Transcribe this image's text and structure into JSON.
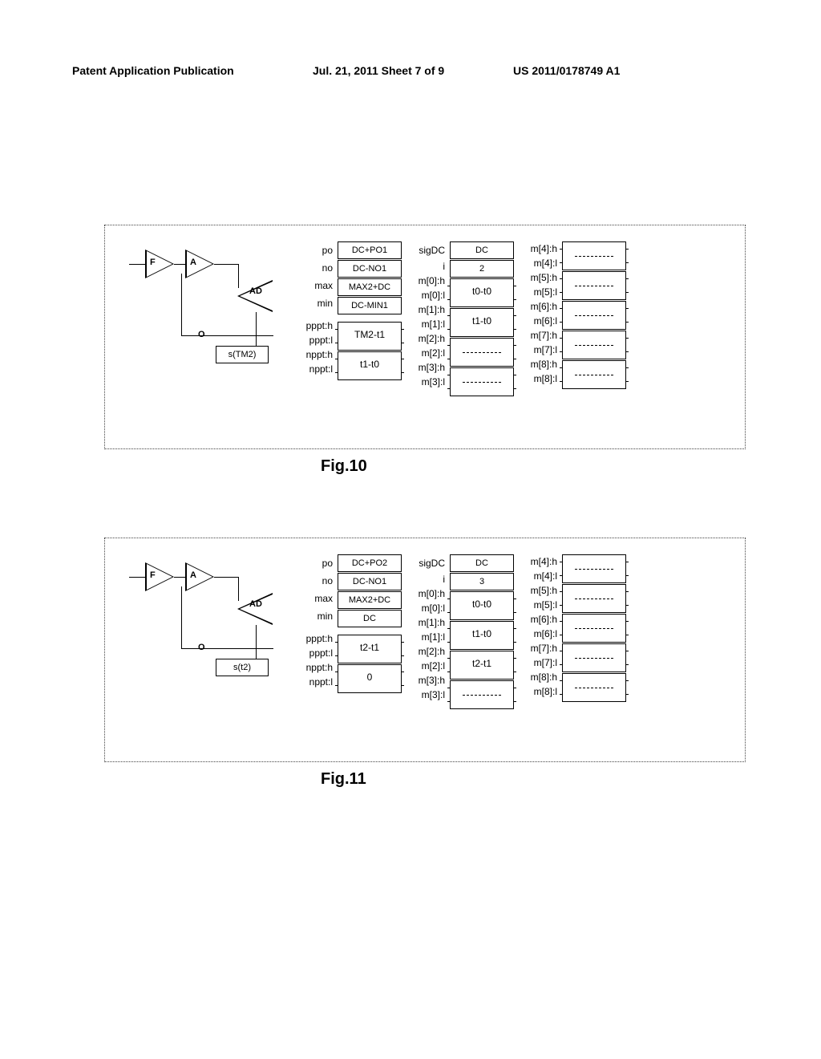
{
  "header": {
    "left": "Patent Application Publication",
    "mid": "Jul. 21, 2011  Sheet 7 of 9",
    "right": "US 2011/0178749 A1"
  },
  "fig10": {
    "label": "Fig.10",
    "schematic": {
      "F": "F",
      "A": "A",
      "AD": "AD",
      "O": "O",
      "s": "s(TM2)"
    },
    "col1": {
      "labels": [
        "po",
        "no",
        "max",
        "min",
        "pppt:h",
        "pppt:l",
        "nppt:h",
        "nppt:l"
      ],
      "cells4": [
        "DC+PO1",
        "DC-NO1",
        "MAX2+DC",
        "DC-MIN1"
      ],
      "cellsPair": [
        "TM2-t1",
        "t1-t0"
      ]
    },
    "col2": {
      "labels": [
        "sigDC",
        "i",
        "m[0]:h",
        "m[0]:l",
        "m[1]:h",
        "m[1]:l",
        "m[2]:h",
        "m[2]:l",
        "m[3]:h",
        "m[3]:l"
      ],
      "top2": [
        "DC",
        "2"
      ],
      "pairs": [
        "t0-t0",
        "t1-t0",
        "",
        ""
      ]
    },
    "col3": {
      "labels": [
        "m[4]:h",
        "m[4]:l",
        "m[5]:h",
        "m[5]:l",
        "m[6]:h",
        "m[6]:l",
        "m[7]:h",
        "m[7]:l",
        "m[8]:h",
        "m[8]:l"
      ],
      "pairs": [
        "",
        "",
        "",
        "",
        ""
      ]
    }
  },
  "fig11": {
    "label": "Fig.11",
    "schematic": {
      "F": "F",
      "A": "A",
      "AD": "AD",
      "O": "O",
      "s": "s(t2)"
    },
    "col1": {
      "labels": [
        "po",
        "no",
        "max",
        "min",
        "pppt:h",
        "pppt:l",
        "nppt:h",
        "nppt:l"
      ],
      "cells4": [
        "DC+PO2",
        "DC-NO1",
        "MAX2+DC",
        "DC"
      ],
      "cellsPair": [
        "t2-t1",
        "0"
      ]
    },
    "col2": {
      "labels": [
        "sigDC",
        "i",
        "m[0]:h",
        "m[0]:l",
        "m[1]:h",
        "m[1]:l",
        "m[2]:h",
        "m[2]:l",
        "m[3]:h",
        "m[3]:l"
      ],
      "top2": [
        "DC",
        "3"
      ],
      "pairs": [
        "t0-t0",
        "t1-t0",
        "t2-t1",
        ""
      ]
    },
    "col3": {
      "labels": [
        "m[4]:h",
        "m[4]:l",
        "m[5]:h",
        "m[5]:l",
        "m[6]:h",
        "m[6]:l",
        "m[7]:h",
        "m[7]:l",
        "m[8]:h",
        "m[8]:l"
      ],
      "pairs": [
        "",
        "",
        "",
        "",
        ""
      ]
    }
  }
}
